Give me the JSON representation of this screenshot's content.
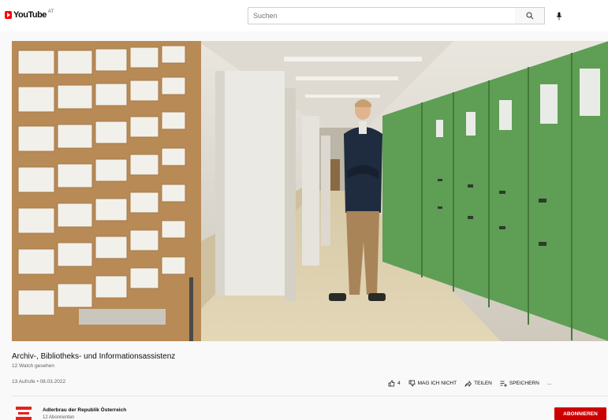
{
  "header": {
    "logo_text": "YouTube",
    "logo_country": "AT",
    "search_placeholder": "Suchen"
  },
  "video": {
    "title": "Archiv-, Bibliotheks- und Informationsassistenz",
    "subline": "12 Watch gesehen",
    "meta": "13 Aufrufe • 08.03.2022"
  },
  "actions": {
    "like_count": "4",
    "dislike_label": "MAG ICH NICHT",
    "share_label": "TEILEN",
    "save_label": "SPEICHERN",
    "more_label": "..."
  },
  "channel": {
    "name": "Adlerbrau der Republik Österreich",
    "subs": "12 Abonnenten",
    "subscribe_label": "ABONNIEREN"
  },
  "colors": {
    "brand_red": "#ff0000",
    "subscribe_red": "#cc0000",
    "cabinet_green": "#5f9e55"
  }
}
